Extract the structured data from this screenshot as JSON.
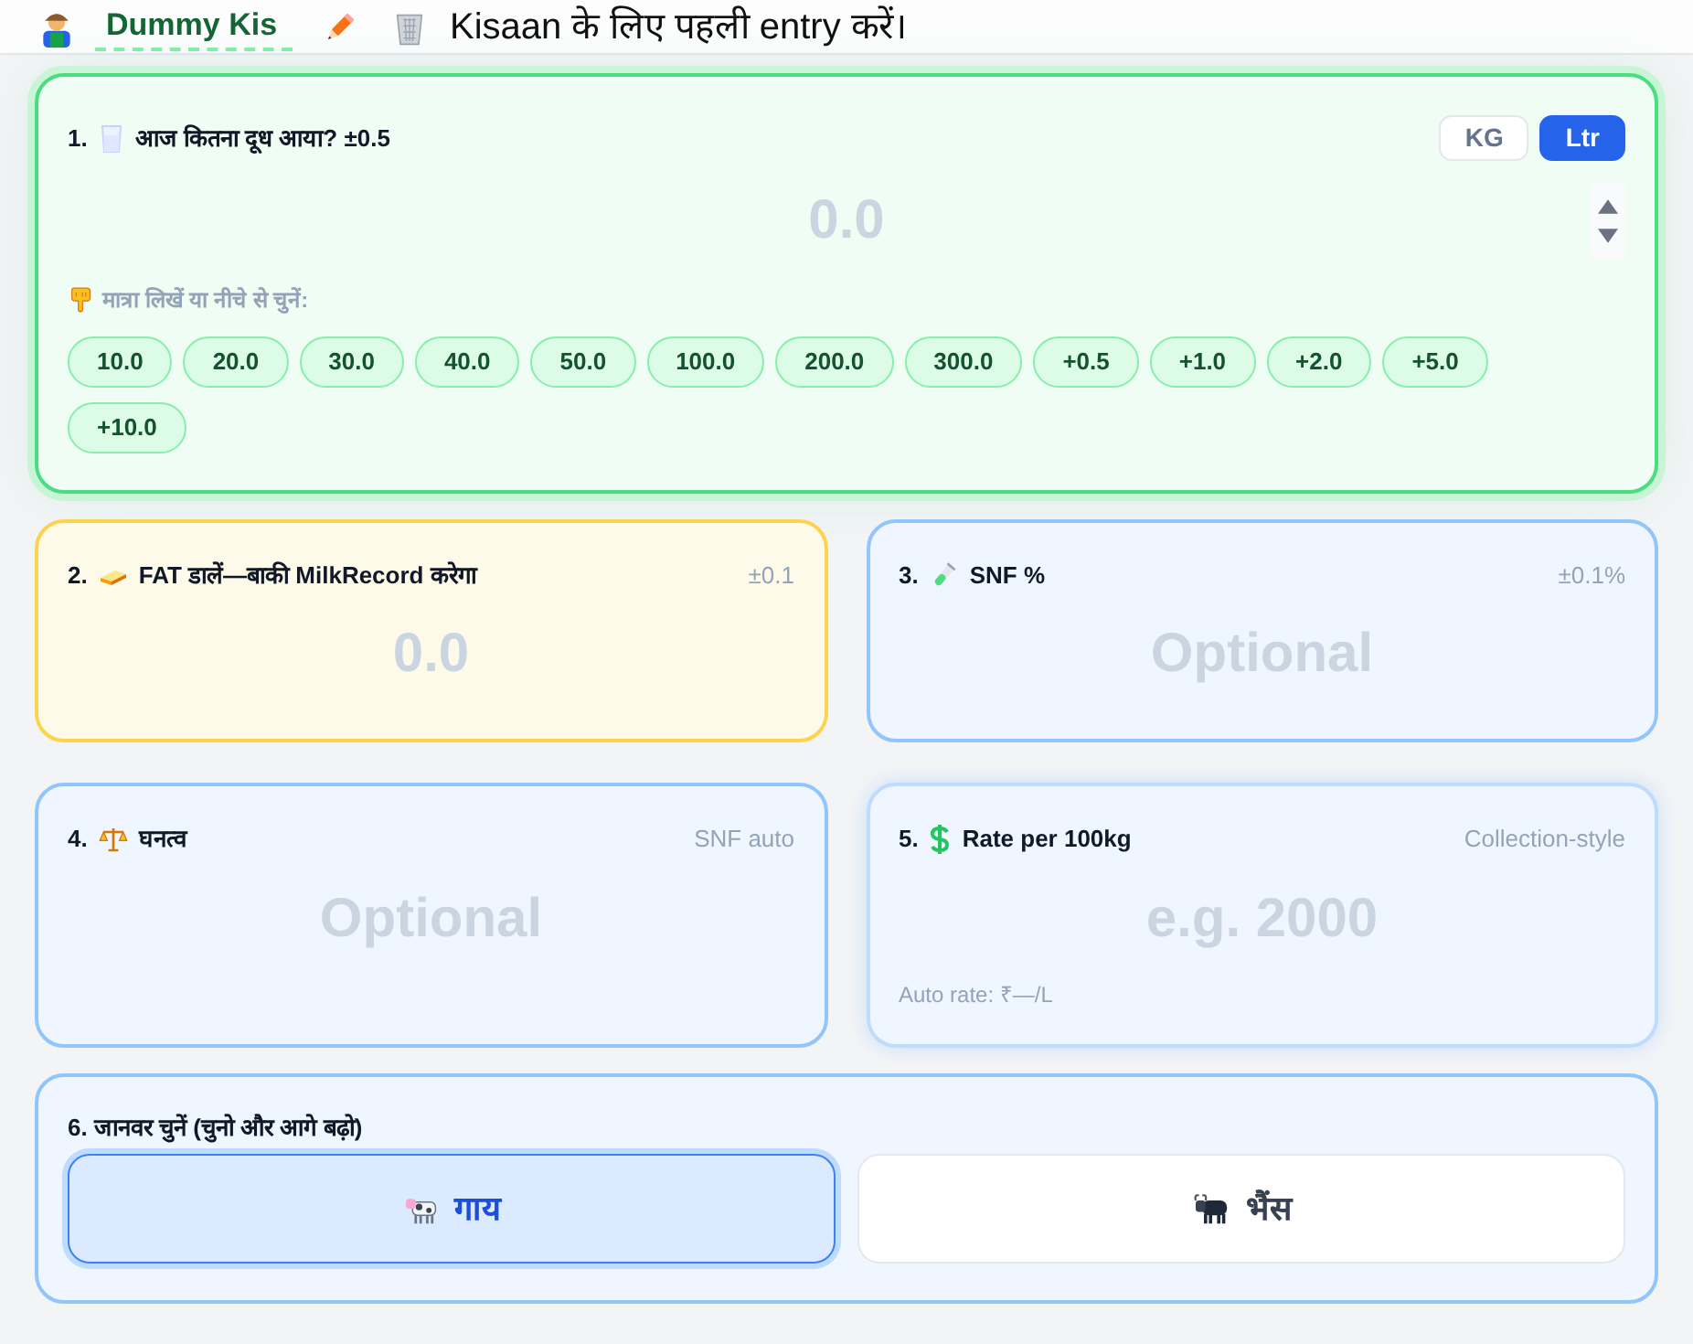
{
  "header": {
    "farmer_name": "Dummy Kis",
    "message": "Kisaan के लिए पहली entry करें।"
  },
  "quantity": {
    "number": "1.",
    "title": "आज कितना दूध आया? ±0.5",
    "units": [
      {
        "label": "KG",
        "selected": false
      },
      {
        "label": "Ltr",
        "selected": true
      }
    ],
    "placeholder": "0.0",
    "hint": "मात्रा लिखें या नीचे से चुनें:",
    "presets": [
      "10.0",
      "20.0",
      "30.0",
      "40.0",
      "50.0",
      "100.0",
      "200.0",
      "300.0",
      "+0.5",
      "+1.0",
      "+2.0",
      "+5.0",
      "+10.0"
    ]
  },
  "fields": [
    {
      "kind": "fat",
      "number": "2.",
      "title": "FAT डालें—बाकी MilkRecord करेगा",
      "note": "±0.1",
      "placeholder": "0.0"
    },
    {
      "kind": "snf",
      "number": "3.",
      "title": "SNF %",
      "note": "±0.1%",
      "placeholder": "Optional"
    },
    {
      "kind": "density",
      "number": "4.",
      "title": "घनत्व",
      "note": "SNF auto",
      "placeholder": "Optional"
    },
    {
      "kind": "rate",
      "number": "5.",
      "title": "Rate per 100kg",
      "note": "Collection-style",
      "placeholder": "e.g. 2000",
      "footer": "Auto rate: ₹—/L"
    }
  ],
  "animal": {
    "title": "6. जानवर चुनें (चुनो और आगे बढ़ो)",
    "options": [
      {
        "kind": "cow",
        "label": "गाय",
        "selected": true
      },
      {
        "kind": "buffalo",
        "label": "भैंस",
        "selected": false
      }
    ]
  }
}
